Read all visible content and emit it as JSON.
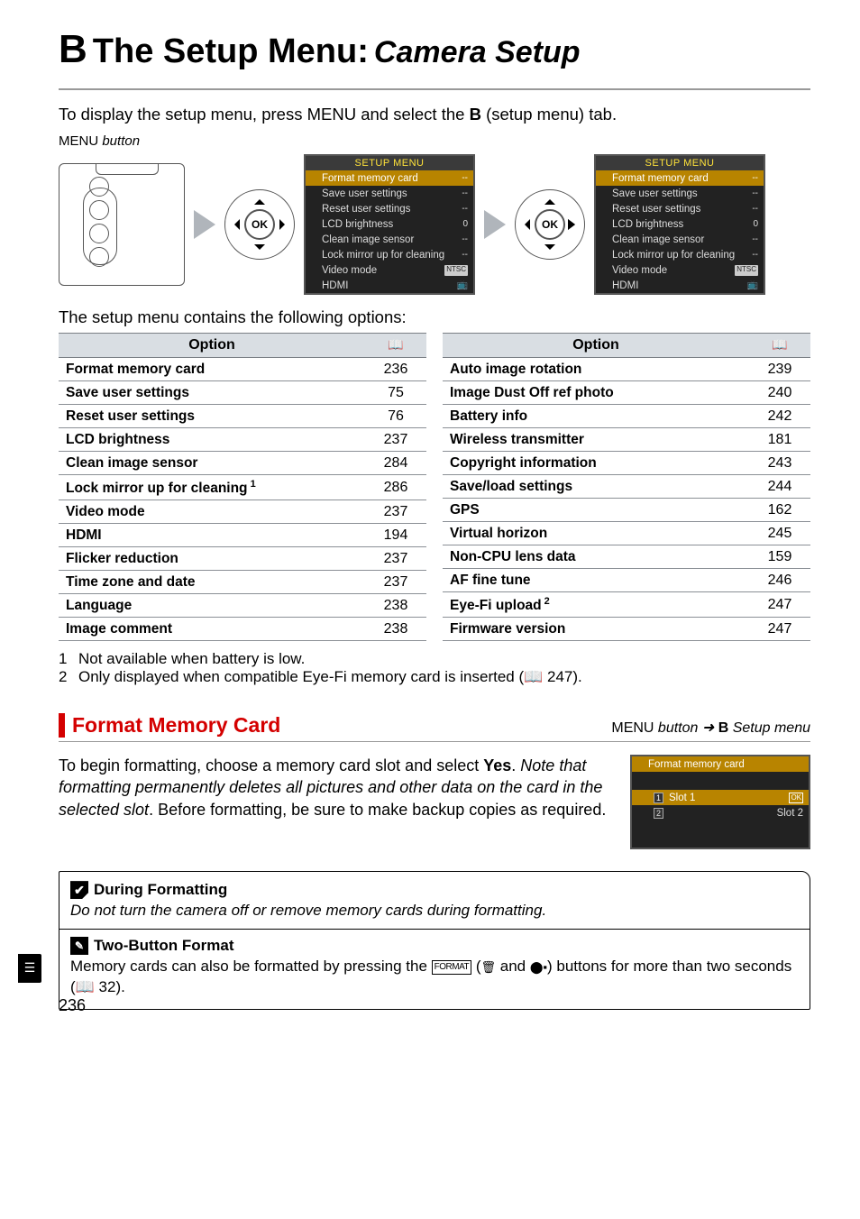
{
  "title": {
    "icon": "B",
    "main": "The Setup Menu:",
    "sub": "Camera Setup"
  },
  "intro": {
    "pre": "To display the setup menu, press ",
    "btn": "MENU",
    "mid": " and select the ",
    "icon": "B",
    "post": " (setup menu) tab."
  },
  "menu_button_label_pre": "MENU",
  "menu_button_label_post": " button",
  "ok_label": "OK",
  "lcd_header": "SETUP MENU",
  "lcd_screen1": [
    {
      "name": "Format memory card",
      "val": "--",
      "sel": true
    },
    {
      "name": "Save user settings",
      "val": "--"
    },
    {
      "name": "Reset user settings",
      "val": "--"
    },
    {
      "name": "LCD brightness",
      "val": "0"
    },
    {
      "name": "Clean image sensor",
      "val": "--"
    },
    {
      "name": "Lock mirror up for cleaning",
      "val": "--"
    },
    {
      "name": "Video mode",
      "val": "NTSC",
      "tag": true
    },
    {
      "name": "HDMI",
      "val": "📺",
      "tv": true
    }
  ],
  "lcd_screen2": [
    {
      "name": "Format memory card",
      "val": "--",
      "sel": true
    },
    {
      "name": "Save user settings",
      "val": "--"
    },
    {
      "name": "Reset user settings",
      "val": "--"
    },
    {
      "name": "LCD brightness",
      "val": "0"
    },
    {
      "name": "Clean image sensor",
      "val": "--"
    },
    {
      "name": "Lock mirror up for cleaning",
      "val": "--"
    },
    {
      "name": "Video mode",
      "val": "NTSC",
      "tag": true
    },
    {
      "name": "HDMI",
      "val": "📺",
      "tv": true
    }
  ],
  "desc": "The setup menu contains the following options:",
  "table_header_option": "Option",
  "page_icon": "📖",
  "table_left": [
    {
      "name": "Format memory card",
      "page": "236"
    },
    {
      "name": "Save user settings",
      "page": "75"
    },
    {
      "name": "Reset user settings",
      "page": "76"
    },
    {
      "name": "LCD brightness",
      "page": "237"
    },
    {
      "name": "Clean image sensor",
      "page": "284"
    },
    {
      "name": "Lock mirror up for cleaning",
      "sup": "1",
      "page": "286"
    },
    {
      "name": "Video mode",
      "page": "237"
    },
    {
      "name": "HDMI",
      "page": "194"
    },
    {
      "name": "Flicker reduction",
      "page": "237"
    },
    {
      "name": "Time zone and date",
      "page": "237"
    },
    {
      "name": "Language",
      "page": "238"
    },
    {
      "name": "Image comment",
      "page": "238"
    }
  ],
  "table_right": [
    {
      "name": "Auto image rotation",
      "page": "239"
    },
    {
      "name": "Image Dust Off ref photo",
      "page": "240"
    },
    {
      "name": "Battery info",
      "page": "242"
    },
    {
      "name": "Wireless transmitter",
      "page": "181"
    },
    {
      "name": "Copyright information",
      "page": "243"
    },
    {
      "name": "Save/load settings",
      "page": "244"
    },
    {
      "name": "GPS",
      "page": "162"
    },
    {
      "name": "Virtual horizon",
      "page": "245"
    },
    {
      "name": "Non-CPU lens data",
      "page": "159"
    },
    {
      "name": "AF fine tune",
      "page": "246"
    },
    {
      "name": "Eye-Fi upload",
      "sup": "2",
      "page": "247"
    },
    {
      "name": "Firmware version",
      "page": "247"
    }
  ],
  "footnotes": [
    {
      "num": "1",
      "text": "Not available when battery is low."
    },
    {
      "num": "2",
      "text": "Only displayed when compatible Eye-Fi memory card is inserted (📖 247)."
    }
  ],
  "section": {
    "title": "Format Memory Card",
    "path_pre": "MENU",
    "path_mid": " button  ➜  ",
    "path_icon": "B",
    "path_post": " Setup menu"
  },
  "format": {
    "p1a": "To begin formatting, choose a memory card slot and select ",
    "p1b": "Yes",
    "p1c": ". ",
    "em": "Note that formatting permanently deletes all pictures and other data on the card in the selected slot",
    "p2": ".  Before formatting, be sure to make backup copies as required.",
    "lcd_title": "Format memory card",
    "slot1": "Slot 1",
    "slot2": "Slot 2",
    "ok_box": "OK"
  },
  "note1": {
    "heading": "During Formatting",
    "body": "Do not turn the camera off or remove memory cards during formatting."
  },
  "note2": {
    "heading": "Two-Button Format",
    "body_a": "Memory cards can also be formatted by pressing the ",
    "format_tag": "FORMAT",
    "body_b": " (",
    "trash": "🗑",
    "body_c": " and ",
    "meter": "⬤▪",
    "body_d": ") buttons for more than two seconds (📖 32)."
  },
  "side_tab": "☰",
  "page_number": "236"
}
